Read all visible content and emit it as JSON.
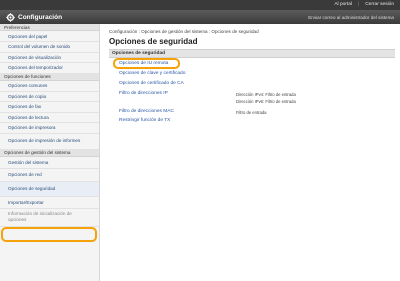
{
  "topbar": {
    "portal": "Al portal",
    "logout": "Cerrar sesión"
  },
  "header": {
    "title": "Configuración",
    "mail_admin": "Enviar correo al administrador del sistema"
  },
  "sidebar": {
    "groups": [
      {
        "label": "Preferencias",
        "items": [
          "Opciones del papel",
          "Control del volumen de sonido",
          "Opciones de visualización",
          "Opciones del temporizador"
        ]
      },
      {
        "label": "Opciones de funciones",
        "items": [
          "Opciones comunes",
          "Opciones de copia",
          "Opciones de fax",
          "Opciones de lectura",
          "Opciones de impresora",
          "Opciones de impresión de informes"
        ]
      },
      {
        "label": "Opciones de gestión del sistema",
        "items": [
          "Gestión del sistema",
          "Opciones de red",
          "Opciones de seguridad",
          "Importar/Exportar",
          "Información de inicialización de opciones"
        ]
      }
    ]
  },
  "main": {
    "breadcrumb": "Configuración : Opciones de gestión del sistema : Opciones de seguridad",
    "title": "Opciones de seguridad",
    "section": "Opciones de seguridad",
    "options": [
      {
        "label": "Opciones de IU remota",
        "status": []
      },
      {
        "label": "Opciones de clave y certificado",
        "status": []
      },
      {
        "label": "Opciones de certificado de CA",
        "status": []
      },
      {
        "label": "Filtro de direcciones IP",
        "status": [
          "Dirección IPv4: Filtro de entrada",
          "Dirección IPv6: Filtro de entrada"
        ]
      },
      {
        "label": "Filtro de direcciones MAC",
        "status": [
          "Filtro de entrada"
        ]
      },
      {
        "label": "Restringir función de TX",
        "status": []
      }
    ]
  },
  "colors": {
    "accent_highlight": "#f5a20a",
    "link": "#2a56a6",
    "header": "#444444"
  },
  "icons": {
    "header_icon": "gear-icon"
  }
}
